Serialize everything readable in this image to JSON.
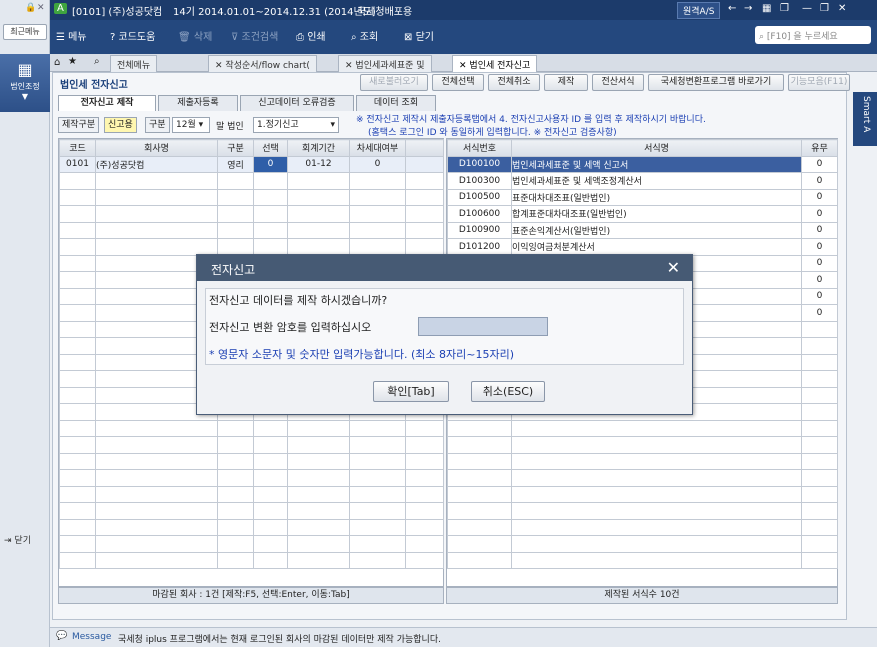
{
  "left": {
    "recent": "최근메뉴",
    "corp_label": "법인조정",
    "close_label": "닫기"
  },
  "title": {
    "company": "[0101] (주)성공닷컴",
    "period": "14기 2014.01.01~2014.12.31 (2014년도)",
    "mode": "국세청배포용",
    "remote": "원격A/S"
  },
  "toolbar": {
    "menu": "메뉴",
    "code": "코드도움",
    "delete": "삭제",
    "condition": "조건검색",
    "print": "인쇄",
    "view": "조회",
    "close": "닫기",
    "search_placeholder": "[F10] 을 누르세요"
  },
  "tabs": [
    "전체메뉴",
    "작성순서/flow chart(",
    "법인세과세표준 및",
    "법인세 전자신고"
  ],
  "page": {
    "title": "법인세 전자신고"
  },
  "buttons": [
    "새로불러오기",
    "전체선택",
    "전체취소",
    "제작",
    "전산서식",
    "국세청변환프로그램 바로가기",
    "기능모음(F11)"
  ],
  "subtabs": [
    "전자신고 제작",
    "제출자등록",
    "신고데이터 오류검증",
    "데이터 조회"
  ],
  "filter": {
    "label1": "제작구분",
    "value1": "신고용",
    "label2": "구분",
    "month": "12월",
    "suffix": "말 법인",
    "type": "1.정기신고"
  },
  "notice": {
    "line1": "※ 전자신고 제작시 제출자등록탭에서 4. 전자신고사용자 ID 를 입력 후 제작하시기 바랍니다.",
    "line2": "(홈택스 로그인 ID 와 동일하게 입력합니다. ※ 전자신고 검증사항)"
  },
  "left_grid": {
    "headers": [
      "코드",
      "회사명",
      "구분",
      "선택",
      "회계기간",
      "차세대여부"
    ],
    "rows": [
      [
        "0101",
        "(주)성공닷컴",
        "영리",
        "0",
        "01-12",
        "0"
      ]
    ],
    "footer": "마감된 회사 : 1건 [제작:F5, 선택:Enter, 이동:Tab]"
  },
  "right_grid": {
    "headers": [
      "서식번호",
      "서식명",
      "유무"
    ],
    "rows": [
      [
        "D100100",
        "법인세과세표준 및 세액 신고서",
        "0"
      ],
      [
        "D100300",
        "법인세과세표준 및 세액조정계산서",
        "0"
      ],
      [
        "D100500",
        "표준대차대조표(일반법인)",
        "0"
      ],
      [
        "D100600",
        "합계표준대차대조표(일반법인)",
        "0"
      ],
      [
        "D100900",
        "표준손익계산서(일반법인)",
        "0"
      ],
      [
        "D101200",
        "이익잉여금처분계산서",
        "0"
      ],
      [
        "",
        "",
        "0"
      ],
      [
        "",
        "",
        "0"
      ],
      [
        "",
        "",
        "0"
      ],
      [
        "",
        "",
        "0"
      ]
    ],
    "footer": "제작된 서식수 10건"
  },
  "message": {
    "label": "Message",
    "text": "국세청 iplus 프로그램에서는 현재 로그인된 회사의 마감된 데이터만 제작 가능합니다."
  },
  "smart": "Smart A",
  "dialog": {
    "title": "전자신고",
    "question": "전자신고 데이터를 제작 하시겠습니까?",
    "prompt": "전자신고 변환 암호를 입력하십시오",
    "hint": "* 영문자 소문자 및 숫자만 입력가능합니다. (최소 8자리~15자리)",
    "ok": "확인[Tab]",
    "cancel": "취소(ESC)"
  }
}
